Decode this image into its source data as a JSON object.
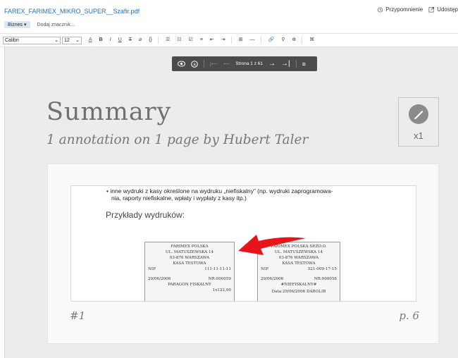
{
  "header": {
    "filename": "FAREX_FARIMEX_MIKRO_SUPER__Szafir.pdf",
    "reminder_label": "Przypomnienie",
    "share_label": "Udostęp"
  },
  "tags": {
    "category": "Biznes",
    "add_tag": "Dodaj znacznik..."
  },
  "toolbar": {
    "font": "Calibri",
    "size": "12",
    "buttons": [
      "A",
      "B",
      "I",
      "U",
      "T",
      "⌀",
      "{}",
      "☰",
      "☷",
      "☑",
      "≡",
      "⇤",
      "⇥",
      "⊞",
      "—",
      "🔗",
      "⚲",
      "⊕",
      "⌘"
    ]
  },
  "pdf_toolbar": {
    "page_label": "Strona 1 z 61"
  },
  "summary": {
    "title": "Summary",
    "subtitle": "1 annotation on 1 page by Hubert Taler",
    "badge_count": "x1"
  },
  "annotation": {
    "number": "#1",
    "page": "p. 6",
    "bullet_line1": "• inne wydruki z kasy określone na wydruku „niefiskalny” (np. wydruki zaprogramowa-",
    "bullet_line2": "nia, raporty niefiskalne, wpłaty i wypłaty z kasy itp.)",
    "heading": "Przykłady wydruków:",
    "receipt1": {
      "l1": "FARIMEX POLSKA",
      "l2": "UL. MATUSZEWSKA 14",
      "l3": "03-876 WARSZAWA",
      "l4": "KASA TESTOWA",
      "nip_label": "NIP",
      "nip": "111-11-11-11",
      "date": "29/06/2006",
      "nr": "NR:000059",
      "type": "PARAGON FISKALNY",
      "amount": "1x122,00"
    },
    "receipt2": {
      "l1": "FARIMEX POLSKA SP.ZO.O.",
      "l2": "UL. MATUSZEWSKA 14",
      "l3": "03-876 WARSZAWA",
      "l4": "KASA TESTOWA",
      "nip_label": "NIP",
      "nip": "521-009-17-15",
      "date": "29/06/2006",
      "nr": "NR:000058",
      "type": "#NIEFISKALNY#",
      "extra": "Data:29/06/2006   DABOLIB"
    }
  },
  "colors": {
    "accent": "#2a6ebb",
    "arrow": "#e8141b"
  }
}
